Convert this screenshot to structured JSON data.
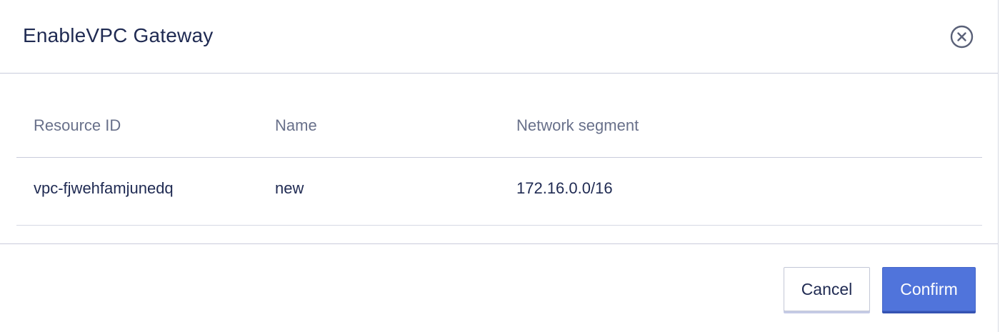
{
  "dialog": {
    "title": "EnableVPC Gateway",
    "close_icon": "close-circle-icon"
  },
  "table": {
    "columns": [
      "Resource ID",
      "Name",
      "Network segment"
    ],
    "rows": [
      [
        "vpc-fjwehfamjunedq",
        "new",
        "172.16.0.0/16"
      ]
    ]
  },
  "footer": {
    "cancel_label": "Cancel",
    "confirm_label": "Confirm"
  },
  "colors": {
    "primary": "#5074db",
    "title_text": "#1f2a52",
    "header_text": "#68708a",
    "divider": "#c9ccdc"
  }
}
